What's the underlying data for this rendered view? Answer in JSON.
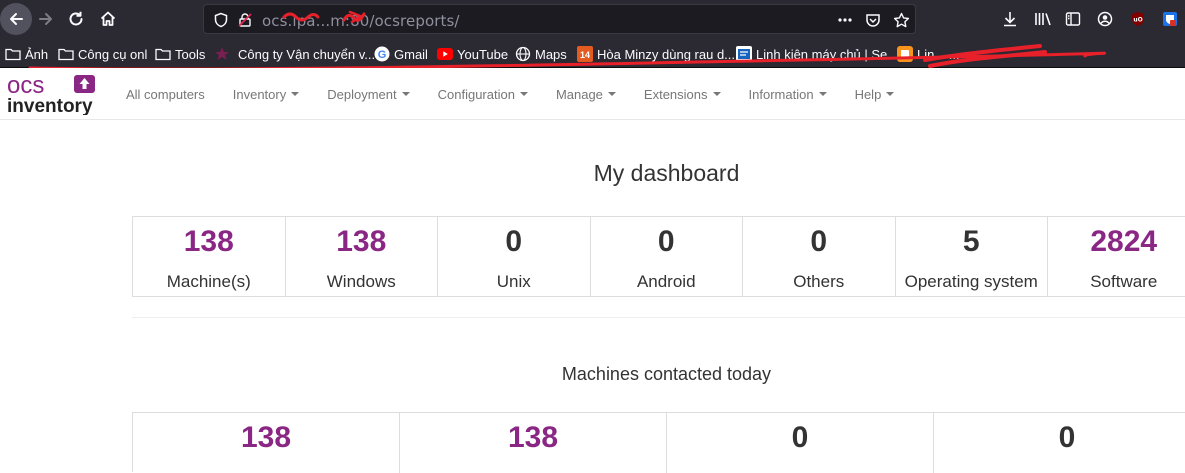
{
  "browser": {
    "url_prefix": "ocs.",
    "url_host_obscured": "ipa...m:80",
    "url_path": "/ocsreports/",
    "bookmarks": [
      {
        "label": "Ảnh",
        "icon": "folder-icon"
      },
      {
        "label": "Công cụ onl",
        "icon": "folder-icon"
      },
      {
        "label": "Tools",
        "icon": "folder-icon"
      },
      {
        "label": "Công ty Vận chuyển v...",
        "icon": "star-logo-icon"
      },
      {
        "label": "Gmail",
        "icon": "google-icon"
      },
      {
        "label": "YouTube",
        "icon": "youtube-icon"
      },
      {
        "label": "Maps",
        "icon": "globe-icon"
      },
      {
        "label": "Hòa Minzy dùng rau d...",
        "icon": "news-14-icon"
      },
      {
        "label": "Linh kiện máy chủ | Se...",
        "icon": "site-icon"
      },
      {
        "label": "Lin... ...",
        "icon": "orange-site-icon"
      }
    ]
  },
  "app": {
    "logo_top": "ocs",
    "logo_bottom": "inventory",
    "menu": [
      {
        "label": "All computers",
        "dropdown": false
      },
      {
        "label": "Inventory",
        "dropdown": true
      },
      {
        "label": "Deployment",
        "dropdown": true
      },
      {
        "label": "Configuration",
        "dropdown": true
      },
      {
        "label": "Manage",
        "dropdown": true
      },
      {
        "label": "Extensions",
        "dropdown": true
      },
      {
        "label": "Information",
        "dropdown": true
      },
      {
        "label": "Help",
        "dropdown": true
      }
    ]
  },
  "dashboard": {
    "title": "My dashboard",
    "stats": [
      {
        "value": "138",
        "label": "Machine(s)",
        "color": "purple"
      },
      {
        "value": "138",
        "label": "Windows",
        "color": "purple"
      },
      {
        "value": "0",
        "label": "Unix",
        "color": "dark"
      },
      {
        "value": "0",
        "label": "Android",
        "color": "dark"
      },
      {
        "value": "0",
        "label": "Others",
        "color": "dark"
      },
      {
        "value": "5",
        "label": "Operating system",
        "color": "dark"
      },
      {
        "value": "2824",
        "label": "Software",
        "color": "purple"
      }
    ],
    "contacted_title": "Machines contacted today",
    "contacted": [
      {
        "value": "138",
        "color": "purple"
      },
      {
        "value": "138",
        "color": "purple"
      },
      {
        "value": "0",
        "color": "dark"
      },
      {
        "value": "0",
        "color": "dark"
      }
    ]
  },
  "colors": {
    "accent_purple": "#8a2683",
    "browser_toolbar": "#2b2a33",
    "annotation_red": "#e8202a"
  }
}
